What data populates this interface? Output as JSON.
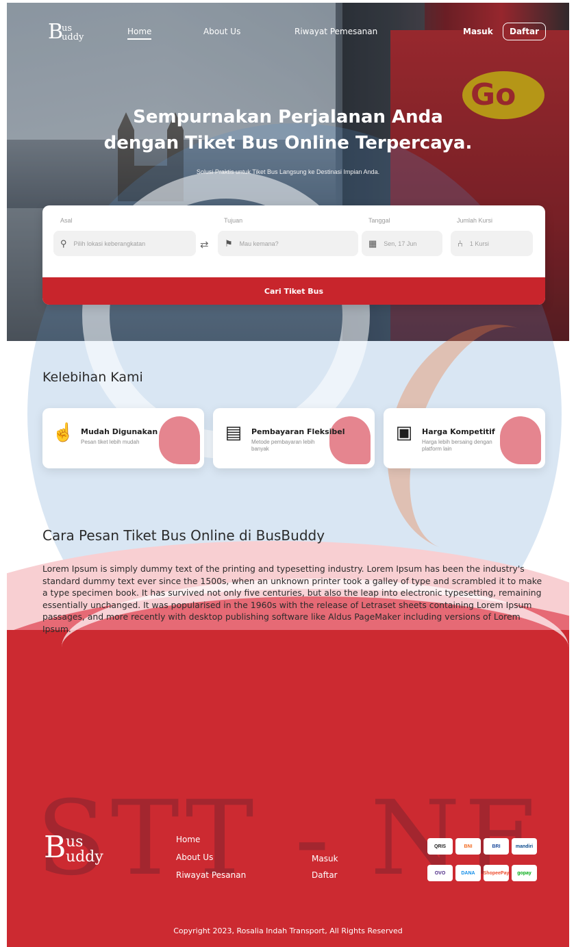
{
  "brand": {
    "big": "B",
    "line1": "us",
    "line2": "uddy"
  },
  "nav": {
    "home": "Home",
    "about": "About Us",
    "riwayat": "Riwayat Pemesanan",
    "masuk": "Masuk",
    "daftar": "Daftar"
  },
  "hero": {
    "line1": "Sempurnakan Perjalanan Anda",
    "line2": "dengan Tiket Bus Online Terpercaya.",
    "subtitle": "Solusi Praktis untuk Tiket Bus Langsung ke Destinasi Impian Anda.",
    "bus_logo": "Go"
  },
  "search": {
    "asal_label": "Asal",
    "asal_placeholder": "Pilih lokasi keberangkatan",
    "tujuan_label": "Tujuan",
    "tujuan_placeholder": "Mau kemana?",
    "tanggal_label": "Tanggal",
    "tanggal_value": "Sen, 17 Jun",
    "kursi_label": "Jumlah Kursi",
    "kursi_value": "1 Kursi",
    "button": "Cari Tiket Bus"
  },
  "kelebihan": {
    "title": "Kelebihan Kami",
    "cards": [
      {
        "title": "Mudah Digunakan",
        "desc": "Pesan tiket lebih mudah",
        "icon": "easy-hand-icon"
      },
      {
        "title": "Pembayaran Fleksibel",
        "desc": "Metode pembayaran lebih banyak",
        "icon": "pay-card-icon"
      },
      {
        "title": "Harga Kompetitif",
        "desc": "Harga lebih bersaing dengan platform lain",
        "icon": "money-icon"
      }
    ]
  },
  "cara": {
    "title": "Cara Pesan Tiket Bus Online di BusBuddy",
    "body": "Lorem Ipsum is simply dummy text of the printing and typesetting industry. Lorem Ipsum has been the industry's standard dummy text ever since the 1500s, when an unknown printer took a galley of type and scrambled it to make a type specimen book. It has survived not only five centuries, but also the leap into electronic typesetting, remaining essentially unchanged. It was popularised in the 1960s with the release of Letraset sheets containing Lorem Ipsum passages, and more recently with desktop publishing software like Aldus PageMaker including versions of Lorem Ipsum."
  },
  "footer": {
    "links": {
      "home": "Home",
      "about": "About Us",
      "riwayat": "Riwayat Pesanan",
      "masuk": "Masuk",
      "daftar": "Daftar"
    },
    "payments": [
      "QRIS",
      "BNI",
      "BRI",
      "mandiri",
      "OVO",
      "DANA",
      "ShopeePay",
      "gopay"
    ],
    "copyright": "Copyright 2023, Rosalia Indah Transport, All Rights Reserved"
  },
  "watermark": "STT - NF",
  "colors": {
    "primary_red": "#c8252c",
    "footer_red": "#cc2a31",
    "watermark_blue": "#508cc8"
  }
}
